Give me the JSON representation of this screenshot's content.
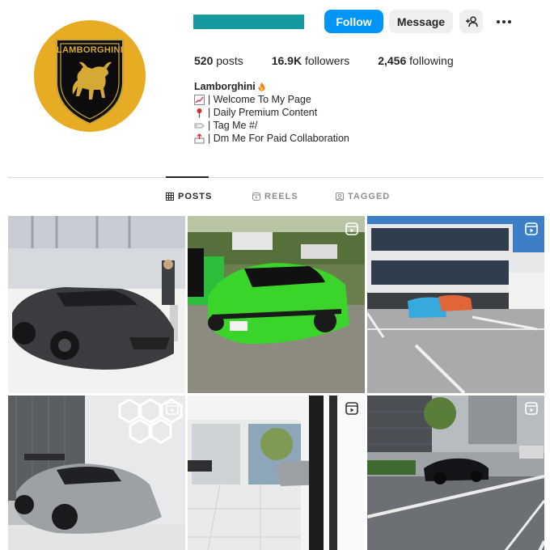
{
  "profile": {
    "avatar_logo_text": "LAMBORGHINI",
    "follow_label": "Follow",
    "message_label": "Message"
  },
  "stats": {
    "posts_count": "520",
    "posts_label": "posts",
    "followers_count": "16.9K",
    "followers_label": "followers",
    "following_count": "2,456",
    "following_label": "following"
  },
  "bio": {
    "name": "Lamborghini",
    "lines": [
      {
        "icon": "chart-emoji-icon",
        "text": "| Welcome To My Page"
      },
      {
        "icon": "pushpin-emoji-icon",
        "text": "| Daily Premium Content"
      },
      {
        "icon": "label-emoji-icon",
        "text": "| Tag Me #/"
      },
      {
        "icon": "outbox-emoji-icon",
        "text": "| Dm Me For Paid Collaboration"
      }
    ]
  },
  "tabs": [
    {
      "label": "POSTS",
      "icon": "grid-icon",
      "active": true
    },
    {
      "label": "REELS",
      "icon": "reels-icon",
      "active": false
    },
    {
      "label": "TAGGED",
      "icon": "tagged-icon",
      "active": false
    }
  ],
  "grid": [
    {
      "subject": "gray-lamborghini-factory",
      "reel": false
    },
    {
      "subject": "green-lamborghini-aventador",
      "reel": true
    },
    {
      "subject": "parking-lot-building",
      "reel": true
    },
    {
      "subject": "widebody-huracan-hexagon-lights",
      "reel": true
    },
    {
      "subject": "showroom-window",
      "reel": true
    },
    {
      "subject": "black-lamborghini-street",
      "reel": true
    }
  ],
  "colors": {
    "follow_blue": "#0095f6",
    "username_redaction": "#159aa0",
    "avatar_gold": "#e8ac24"
  }
}
